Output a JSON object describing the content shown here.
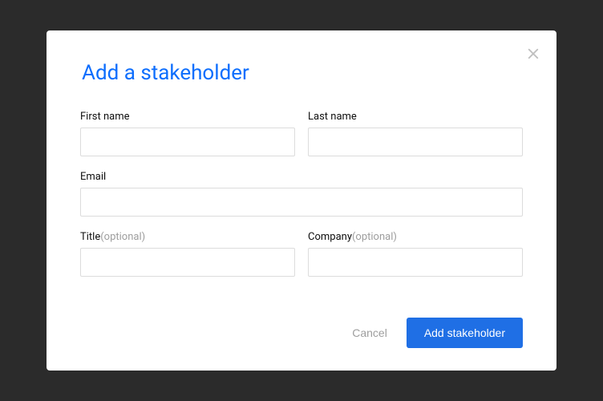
{
  "modal": {
    "title": "Add a stakeholder",
    "fields": {
      "first_name": {
        "label": "First name",
        "value": ""
      },
      "last_name": {
        "label": "Last name",
        "value": ""
      },
      "email": {
        "label": "Email",
        "value": ""
      },
      "title": {
        "label": "Title",
        "optional": "(optional)",
        "value": ""
      },
      "company": {
        "label": "Company",
        "optional": "(optional)",
        "value": ""
      }
    },
    "buttons": {
      "cancel": "Cancel",
      "submit": "Add stakeholder"
    }
  },
  "colors": {
    "primary": "#1f6fe5",
    "title": "#0d6efd",
    "backdrop": "#2b2b2b"
  }
}
